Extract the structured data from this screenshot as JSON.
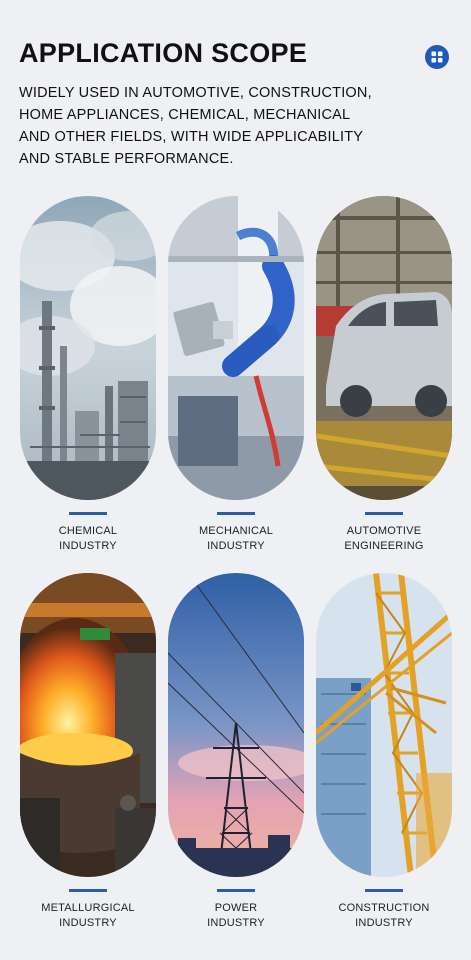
{
  "header": {
    "title": "APPLICATION SCOPE",
    "description_lines": [
      "WIDELY USED IN AUTOMOTIVE, CONSTRUCTION,",
      "HOME APPLIANCES, CHEMICAL, MECHANICAL",
      "AND OTHER FIELDS, WITH WIDE APPLICABILITY",
      "AND STABLE PERFORMANCE."
    ],
    "icon": "grid-icon"
  },
  "applications": [
    {
      "line1": "CHEMICAL",
      "line2": "INDUSTRY",
      "image": "chemical-plant-image"
    },
    {
      "line1": "MECHANICAL",
      "line2": "INDUSTRY",
      "image": "robot-arm-image"
    },
    {
      "line1": "AUTOMOTIVE",
      "line2": "ENGINEERING",
      "image": "car-body-assembly-image"
    },
    {
      "line1": "METALLURGICAL",
      "line2": "INDUSTRY",
      "image": "molten-steel-furnace-image"
    },
    {
      "line1": "POWER",
      "line2": "INDUSTRY",
      "image": "power-tower-image"
    },
    {
      "line1": "CONSTRUCTION",
      "line2": "INDUSTRY",
      "image": "tower-crane-image"
    }
  ],
  "colors": {
    "background": "#eef0f3",
    "accent": "#2b5ca8",
    "icon": "#1e5bb8"
  }
}
